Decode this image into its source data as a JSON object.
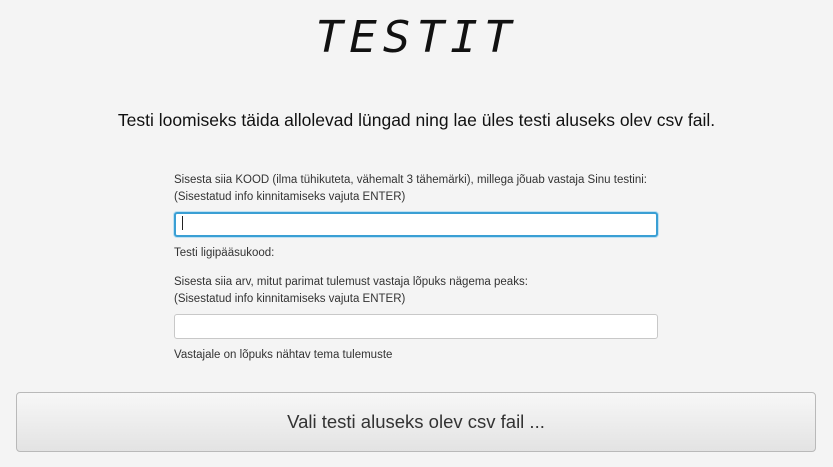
{
  "header": {
    "title": "TESTIT"
  },
  "intro": {
    "text": "Testi loomiseks täida allolevad lüngad ning lae üles testi aluseks olev csv fail."
  },
  "code_section": {
    "instruction": "Sisesta siia KOOD (ilma tühikuteta, vähemalt 3 tähemärki), millega jõuab vastaja Sinu testini:",
    "hint": "(Sisestatud info kinnitamiseks vajuta ENTER)",
    "input_value": "",
    "status_label": "Testi ligipääsukood:"
  },
  "top_results_section": {
    "instruction": "Sisesta siia arv, mitut parimat tulemust vastaja lõpuks nägema peaks:",
    "hint": "(Sisestatud info kinnitamiseks vajuta ENTER)",
    "input_value": "",
    "status_label": "Vastajale on lõpuks nähtav tema tulemuste"
  },
  "actions": {
    "choose_file_label": "Vali testi aluseks olev csv fail ..."
  },
  "colors": {
    "background": "#f4f4f4",
    "focus_border": "#3a9fd4"
  }
}
